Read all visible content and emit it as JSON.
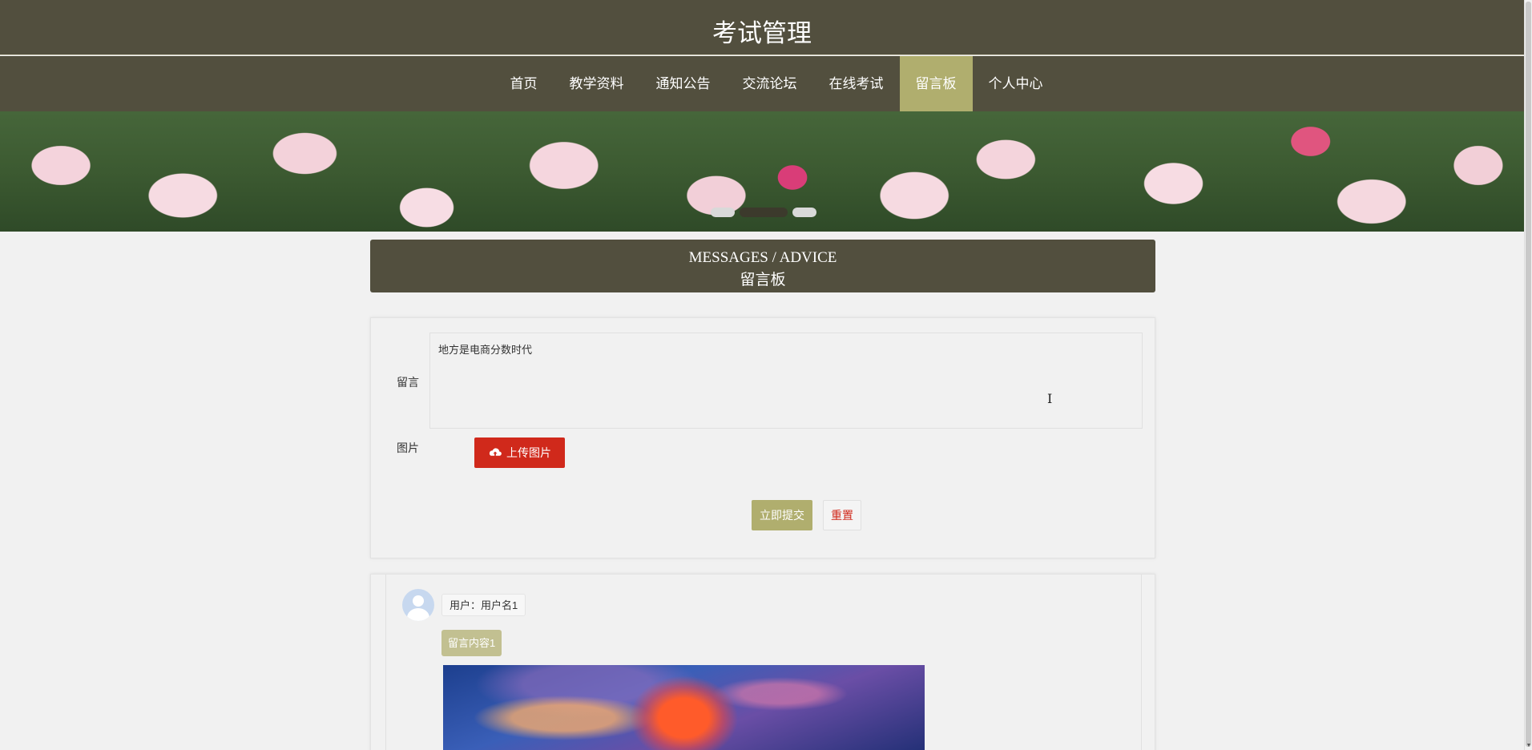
{
  "header": {
    "title": "考试管理"
  },
  "nav": {
    "items": [
      {
        "label": "首页"
      },
      {
        "label": "教学资料"
      },
      {
        "label": "通知公告"
      },
      {
        "label": "交流论坛"
      },
      {
        "label": "在线考试"
      },
      {
        "label": "留言板",
        "active": true
      },
      {
        "label": "个人中心"
      }
    ]
  },
  "banner": {
    "slides": 3,
    "active_slide": 2
  },
  "section": {
    "title_en": "MESSAGES / ADVICE",
    "title_cn": "留言板"
  },
  "form": {
    "message_label": "留言",
    "message_value": "地方是电商分数时代",
    "image_label": "图片",
    "upload_label": "上传图片",
    "submit_label": "立即提交",
    "reset_label": "重置"
  },
  "messages": [
    {
      "user": "用户：用户名1",
      "content": "留言内容1"
    }
  ],
  "colors": {
    "header_bg": "#524f3e",
    "nav_active": "#b0ae6e",
    "upload_button": "#d0291b",
    "submit_button": "#b0ae6e"
  },
  "icons": {
    "upload": "cloud-upload-icon",
    "avatar": "user-avatar-icon"
  }
}
